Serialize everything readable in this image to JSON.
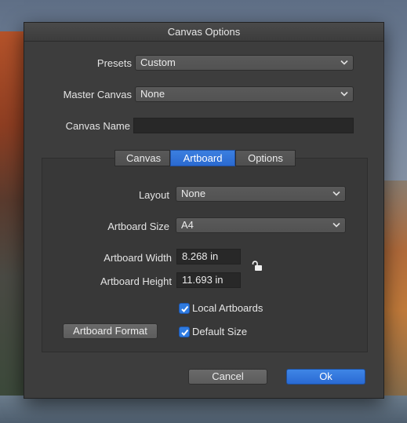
{
  "dialog": {
    "title": "Canvas Options",
    "presets": {
      "label": "Presets",
      "value": "Custom"
    },
    "master_canvas": {
      "label": "Master Canvas",
      "value": "None"
    },
    "canvas_name": {
      "label": "Canvas Name",
      "value": ""
    },
    "tabs": [
      {
        "label": "Canvas",
        "active": false
      },
      {
        "label": "Artboard",
        "active": true
      },
      {
        "label": "Options",
        "active": false
      }
    ],
    "artboard": {
      "layout": {
        "label": "Layout",
        "value": "None"
      },
      "size": {
        "label": "Artboard Size",
        "value": "A4"
      },
      "width": {
        "label": "Artboard Width",
        "value": "8.268 in"
      },
      "height": {
        "label": "Artboard Height",
        "value": "11.693 in"
      },
      "lock_icon": "unlocked-padlock-icon",
      "local_artboards": {
        "label": "Local Artboards",
        "checked": true
      },
      "default_size": {
        "label": "Default Size",
        "checked": true
      },
      "format_button": "Artboard Format"
    },
    "buttons": {
      "cancel": "Cancel",
      "ok": "Ok"
    }
  },
  "colors": {
    "accent": "#2b6ad0",
    "dialog_bg": "#3d3d3d"
  }
}
